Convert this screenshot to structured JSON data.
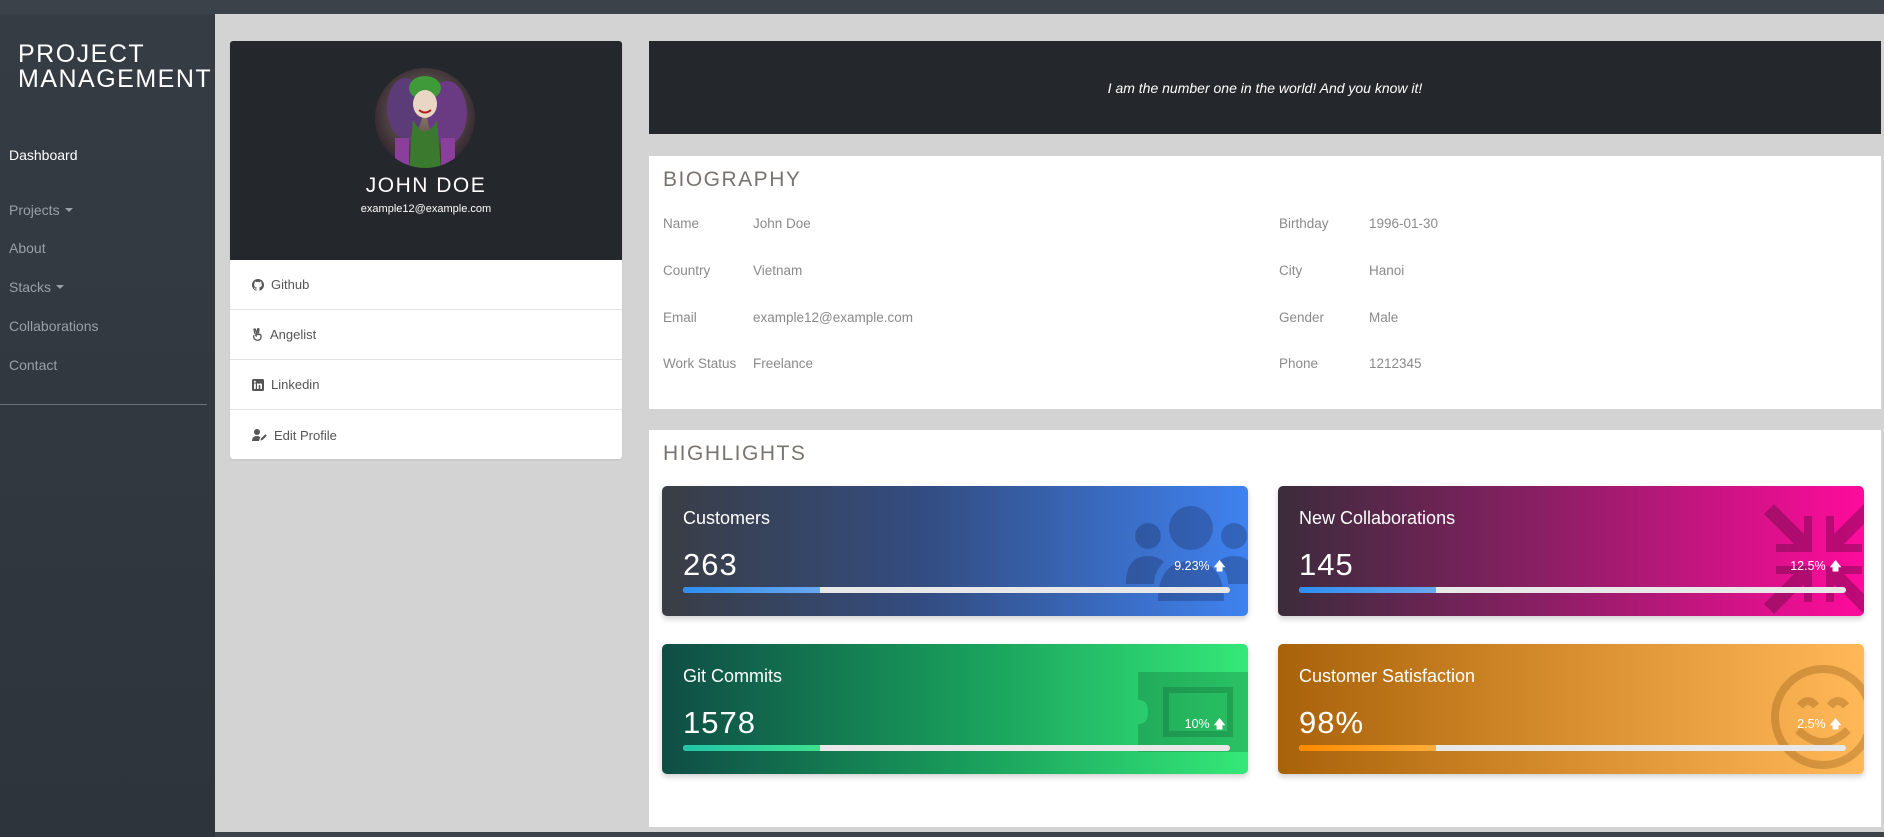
{
  "brand": {
    "line1": "PROJECT",
    "line2": "MANAGEMENT"
  },
  "nav": {
    "dashboard": "Dashboard",
    "projects": "Projects",
    "about": "About",
    "stacks": "Stacks",
    "collaborations": "Collaborations",
    "contact": "Contact"
  },
  "profile": {
    "name": "JOHN DOE",
    "email": "example12@example.com",
    "links": {
      "github": "Github",
      "angelist": "Angelist",
      "linkedin": "Linkedin",
      "edit": "Edit Profile"
    }
  },
  "quote": "I am the number one in the world! And you know it!",
  "biography": {
    "title": "BIOGRAPHY",
    "fields": {
      "name": {
        "label": "Name",
        "value": "John Doe"
      },
      "birthday": {
        "label": "Birthday",
        "value": "1996-01-30"
      },
      "country": {
        "label": "Country",
        "value": "Vietnam"
      },
      "city": {
        "label": "City",
        "value": "Hanoi"
      },
      "email": {
        "label": "Email",
        "value": "example12@example.com"
      },
      "gender": {
        "label": "Gender",
        "value": "Male"
      },
      "work_status": {
        "label": "Work Status",
        "value": "Freelance"
      },
      "phone": {
        "label": "Phone",
        "value": "1212345"
      }
    }
  },
  "highlights": {
    "title": "HIGHLIGHTS",
    "cards": {
      "customers": {
        "title": "Customers",
        "value": "263",
        "change": "9.23%",
        "progress": 0.25,
        "icon": "users-icon"
      },
      "collabs": {
        "title": "New Collaborations",
        "value": "145",
        "change": "12.5%",
        "progress": 0.25,
        "icon": "compress-icon"
      },
      "commits": {
        "title": "Git Commits",
        "value": "1578",
        "change": "10%",
        "progress": 0.25,
        "icon": "ticket-icon"
      },
      "satisfaction": {
        "title": "Customer Satisfaction",
        "value": "98%",
        "change": "2.5%",
        "progress": 0.25,
        "icon": "smile-icon"
      }
    }
  },
  "colors": {
    "sidebar": "#363c44",
    "dark_panel": "#24272c",
    "content_bg": "#d3d3d3",
    "customers_gradient": [
      "#3a3d44",
      "#3f82f0"
    ],
    "collabs_gradient": [
      "#3b2c3b",
      "#ff0b9c"
    ],
    "commits_gradient": [
      "#0f4d45",
      "#34e878"
    ],
    "satisfaction_gradient": [
      "#a8620a",
      "#ffb858"
    ]
  }
}
